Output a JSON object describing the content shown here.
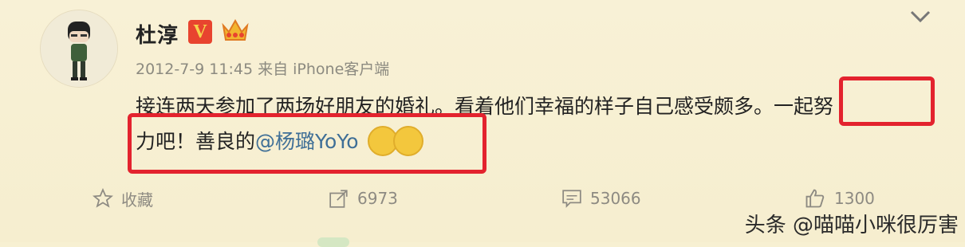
{
  "post": {
    "author": "杜淳",
    "verified_badge": "V",
    "timestamp": "2012-7-9 11:45",
    "source": "来自 iPhone客户端",
    "text_line1": "接连两天参加了两场好朋友的婚礼。看着他们幸福的样子自己感受颇多。一起努",
    "text_line2_prefix": "力吧！善良的",
    "mention": "@杨璐YoYo"
  },
  "actions": {
    "favorite_label": "收藏",
    "repost_count": "6973",
    "comment_count": "53066",
    "like_count": "1300"
  },
  "watermark": "头条 @喵喵小咪很厉害",
  "colors": {
    "background": "#f7f0d2",
    "highlight": "#e3232e",
    "mention": "#3f6f97",
    "verified": "#e8442f"
  }
}
